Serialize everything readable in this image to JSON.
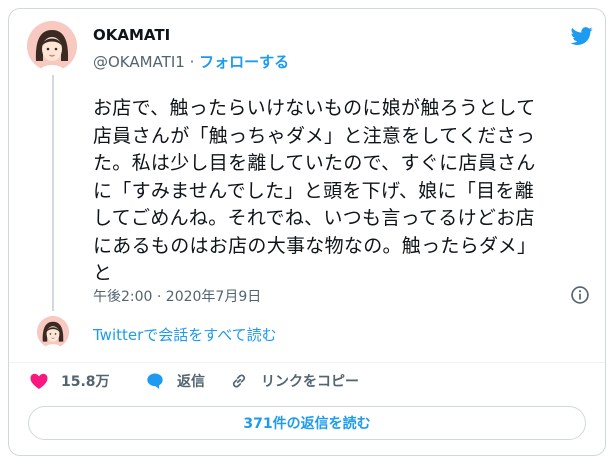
{
  "author": {
    "name": "OKAMATI",
    "handle": "@OKAMATI1",
    "separator": " · ",
    "follow_label": "フォローする"
  },
  "tweet": {
    "lines": [
      "お店で、触ったらいけないものに娘が触ろうとして",
      "店員さんが「触っちゃダメ」と注意をしてくださっ",
      "た。私は少し目を離していたので、すぐに店員さん",
      "に「すみませんでした」と頭を下げ、娘に「目を離",
      "してごめんね。それでね、いつも言ってるけどお店",
      "にあるものはお店の大事な物なの。触ったらダメ」",
      "と"
    ],
    "timestamp": "午後2:00 · 2020年7月9日"
  },
  "conversation_link": "Twitterで会話をすべて読む",
  "actions": {
    "likes": "15.8万",
    "reply": "返信",
    "copy_link": "リンクをコピー"
  },
  "read_replies": "371件の返信を読む",
  "colors": {
    "accent": "#1d9bf0",
    "like": "#f91880",
    "muted": "#536471",
    "border": "#cfd9de"
  },
  "icons": [
    "twitter-bird-icon",
    "info-icon",
    "heart-icon",
    "reply-bubble-icon",
    "link-icon"
  ]
}
